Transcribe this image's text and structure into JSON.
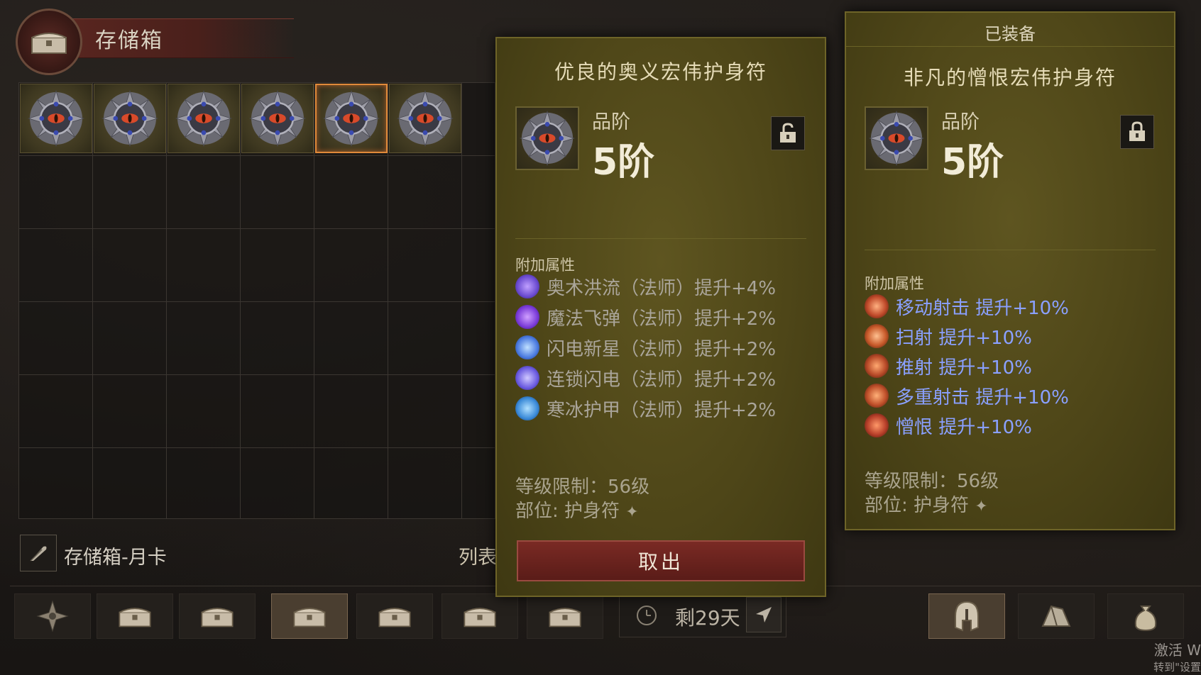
{
  "header": {
    "title": "存储箱"
  },
  "storage": {
    "name": "存储箱-月卡",
    "list_label": "列表",
    "items": [
      "amulet",
      "amulet",
      "amulet",
      "amulet",
      "amulet",
      "amulet"
    ]
  },
  "timer": {
    "text": "剩29天"
  },
  "compare_card": {
    "title": "优良的奥义宏伟护身符",
    "tier_label": "品阶",
    "tier_value": "5阶",
    "section_label": "附加属性",
    "attributes": [
      {
        "text": "奥术洪流（法师）提升+4%",
        "icon_color": "#6a4ad0"
      },
      {
        "text": "魔法飞弹（法师）提升+2%",
        "icon_color": "#7a3ad8"
      },
      {
        "text": "闪电新星（法师）提升+2%",
        "icon_color": "#4a7ae0"
      },
      {
        "text": "连锁闪电（法师）提升+2%",
        "icon_color": "#6a5ae0"
      },
      {
        "text": "寒冰护甲（法师）提升+2%",
        "icon_color": "#3a8ad8"
      }
    ],
    "level_req": "等级限制：56级",
    "slot": "部位: 护身符",
    "takeout_label": "取出"
  },
  "equipped_card": {
    "equipped_label": "已装备",
    "title": "非凡的憎恨宏伟护身符",
    "tier_label": "品阶",
    "tier_value": "5阶",
    "section_label": "附加属性",
    "attributes": [
      {
        "text": "移动射击  提升+10%",
        "icon_color": "#c04a2a"
      },
      {
        "text": "扫射  提升+10%",
        "icon_color": "#c85a2a"
      },
      {
        "text": "推射  提升+10%",
        "icon_color": "#b84a28"
      },
      {
        "text": "多重射击  提升+10%",
        "icon_color": "#c0502a"
      },
      {
        "text": "憎恨  提升+10%",
        "icon_color": "#b8402a"
      }
    ],
    "level_req": "等级限制：56级",
    "slot": "部位: 护身符"
  },
  "tabs": [
    {
      "icon": "compass-icon"
    },
    {
      "icon": "chest-icon"
    },
    {
      "icon": "chest-icon"
    },
    {
      "icon": "chest-icon",
      "active": true
    },
    {
      "icon": "chest-icon"
    },
    {
      "icon": "chest-icon"
    },
    {
      "icon": "chest-icon"
    }
  ],
  "right_tabs": [
    {
      "icon": "helmet-icon",
      "active": true
    },
    {
      "icon": "gem-icon"
    },
    {
      "icon": "bag-icon"
    }
  ],
  "watermark": {
    "line1": "激活 W",
    "line2": "转到\"设置"
  },
  "colors": {
    "accent": "#e08a3a",
    "card_bg": "#5e5520",
    "blue_text": "#8aa0ff",
    "takeout_button": "#7a2a24"
  }
}
